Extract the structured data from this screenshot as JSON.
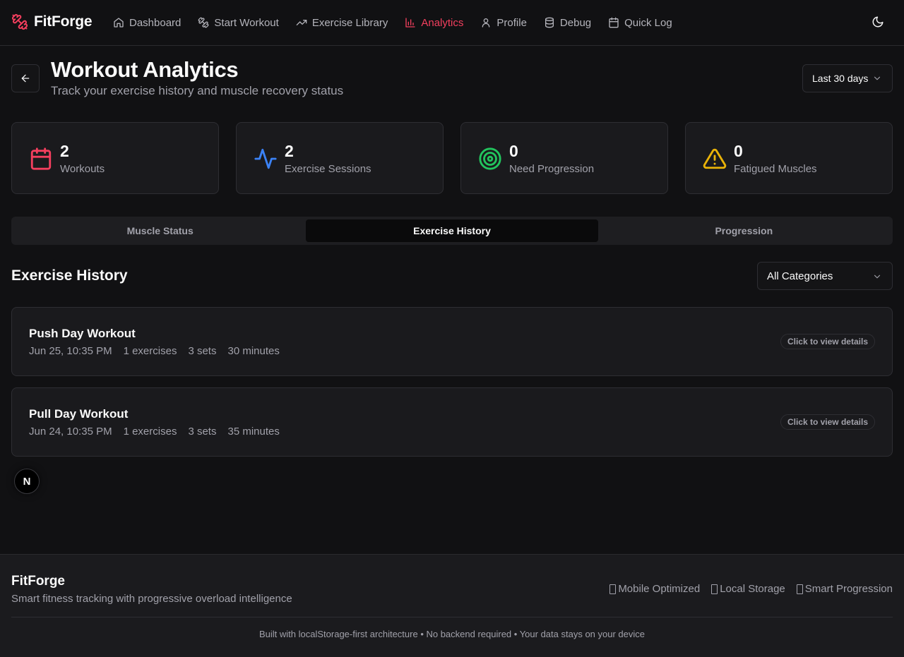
{
  "nav": {
    "brand": "FitForge",
    "items": [
      {
        "label": "Dashboard",
        "icon": "home-icon",
        "active": false
      },
      {
        "label": "Start Workout",
        "icon": "dumbbell-icon",
        "active": false
      },
      {
        "label": "Exercise Library",
        "icon": "trending-up-icon",
        "active": false
      },
      {
        "label": "Analytics",
        "icon": "bar-chart-icon",
        "active": true
      },
      {
        "label": "Profile",
        "icon": "user-icon",
        "active": false
      },
      {
        "label": "Debug",
        "icon": "database-icon",
        "active": false
      },
      {
        "label": "Quick Log",
        "icon": "calendar-icon",
        "active": false
      }
    ],
    "theme_icon": "moon-icon"
  },
  "header": {
    "title": "Workout Analytics",
    "subtitle": "Track your exercise history and muscle recovery status",
    "range": "Last 30 days"
  },
  "stats": [
    {
      "value": "2",
      "label": "Workouts",
      "icon": "calendar-icon",
      "color": "#f43f5e"
    },
    {
      "value": "2",
      "label": "Exercise Sessions",
      "icon": "activity-icon",
      "color": "#3b82f6"
    },
    {
      "value": "0",
      "label": "Need Progression",
      "icon": "target-icon",
      "color": "#22c55e"
    },
    {
      "value": "0",
      "label": "Fatigued Muscles",
      "icon": "alert-triangle-icon",
      "color": "#eab308"
    }
  ],
  "tabs": [
    {
      "label": "Muscle Status",
      "active": false
    },
    {
      "label": "Exercise History",
      "active": true
    },
    {
      "label": "Progression",
      "active": false
    }
  ],
  "history": {
    "title": "Exercise History",
    "category": "All Categories",
    "workouts": [
      {
        "title": "Push Day Workout",
        "date": "Jun 25, 10:35 PM",
        "exercises": "1 exercises",
        "sets": "3 sets",
        "duration": "30 minutes",
        "action": "Click to view details"
      },
      {
        "title": "Pull Day Workout",
        "date": "Jun 24, 10:35 PM",
        "exercises": "1 exercises",
        "sets": "3 sets",
        "duration": "35 minutes",
        "action": "Click to view details"
      }
    ]
  },
  "next_badge": "N",
  "footer": {
    "brand": "FitForge",
    "tagline": "Smart fitness tracking with progressive overload intelligence",
    "features": [
      "Mobile Optimized",
      "Local Storage",
      "Smart Progression"
    ],
    "note": "Built with localStorage-first architecture • No backend required • Your data stays on your device"
  },
  "colors": {
    "accent": "#f43f5e",
    "background": "#111113",
    "card": "#1a1a1d"
  }
}
